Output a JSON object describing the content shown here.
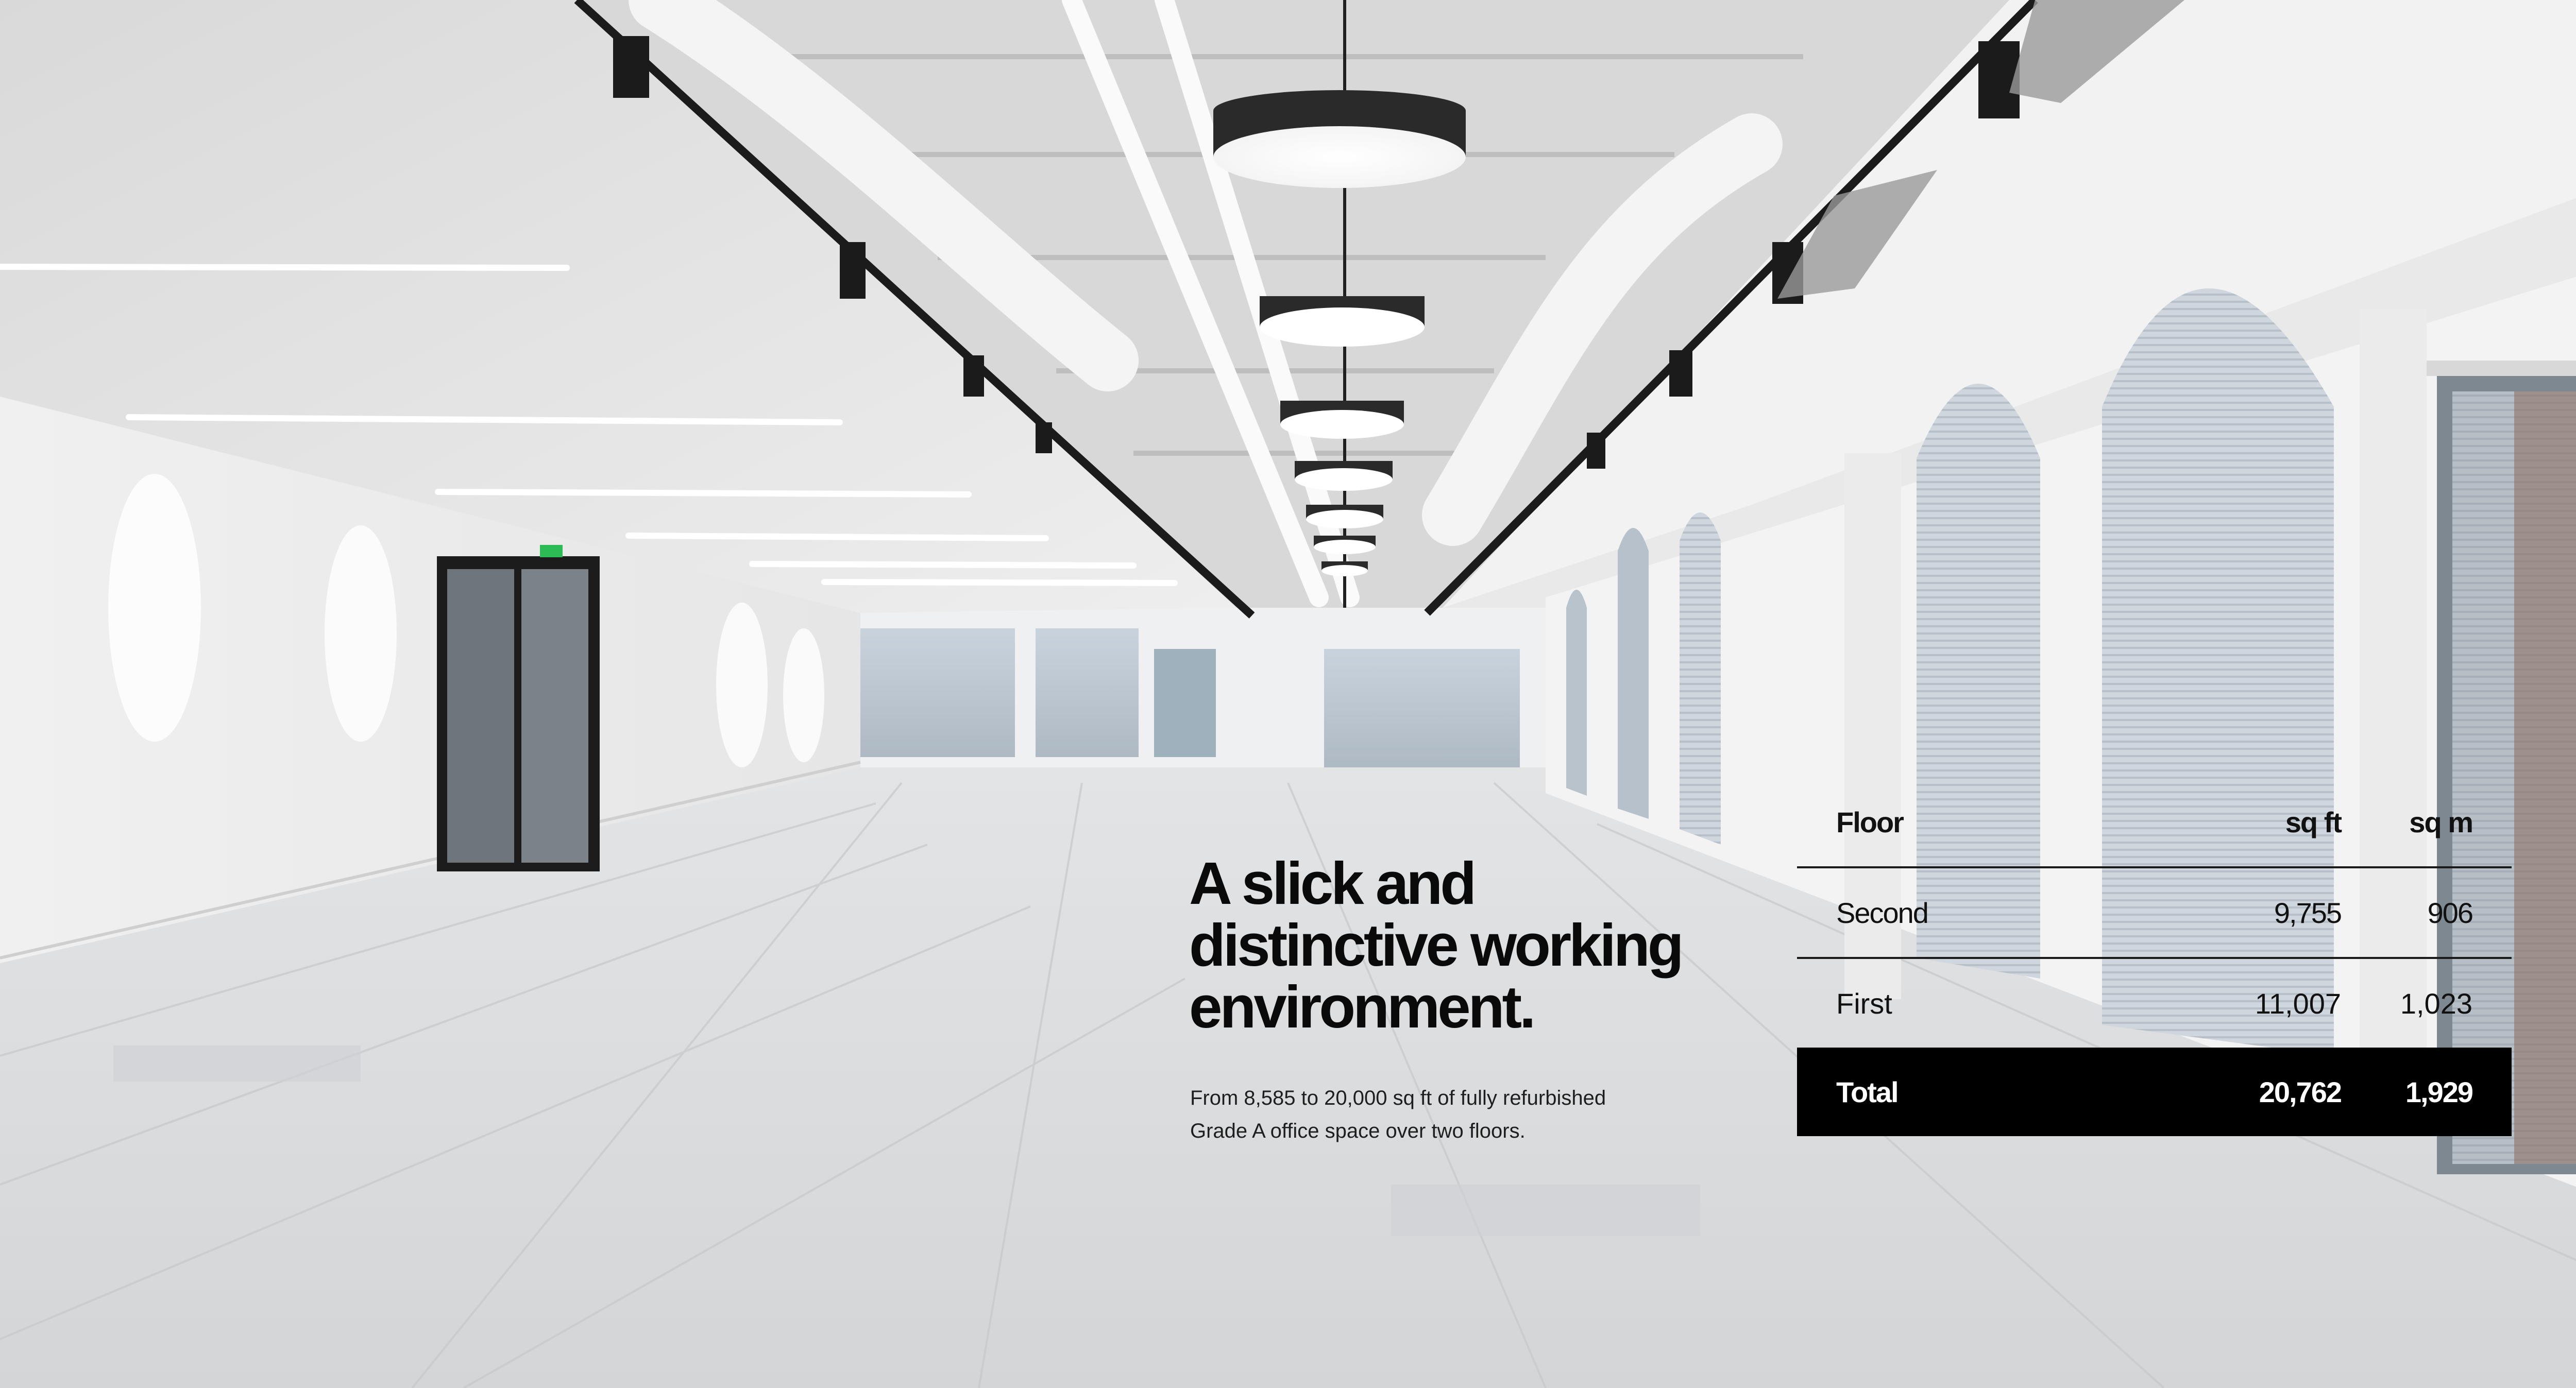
{
  "hero": {
    "headline_lines": [
      "A slick and",
      "distinctive working",
      "environment."
    ],
    "subtext_lines": [
      "From 8,585 to 20,000 sq ft of fully refurbished",
      "Grade A office space over two floors."
    ]
  },
  "table": {
    "headers": {
      "floor": "Floor",
      "sq_ft": "sq ft",
      "sq_m": "sq m"
    },
    "rows": [
      {
        "floor": "Second",
        "sq_ft": "9,755",
        "sq_m": "906"
      },
      {
        "floor": "First",
        "sq_ft": "11,007",
        "sq_m": "1,023"
      }
    ],
    "total": {
      "floor": "Total",
      "sq_ft": "20,762",
      "sq_m": "1,929"
    }
  },
  "colors": {
    "text": "#0a0a0a",
    "total_row_bg": "#000000",
    "total_row_text": "#ffffff",
    "rule": "#1a1a1a"
  }
}
